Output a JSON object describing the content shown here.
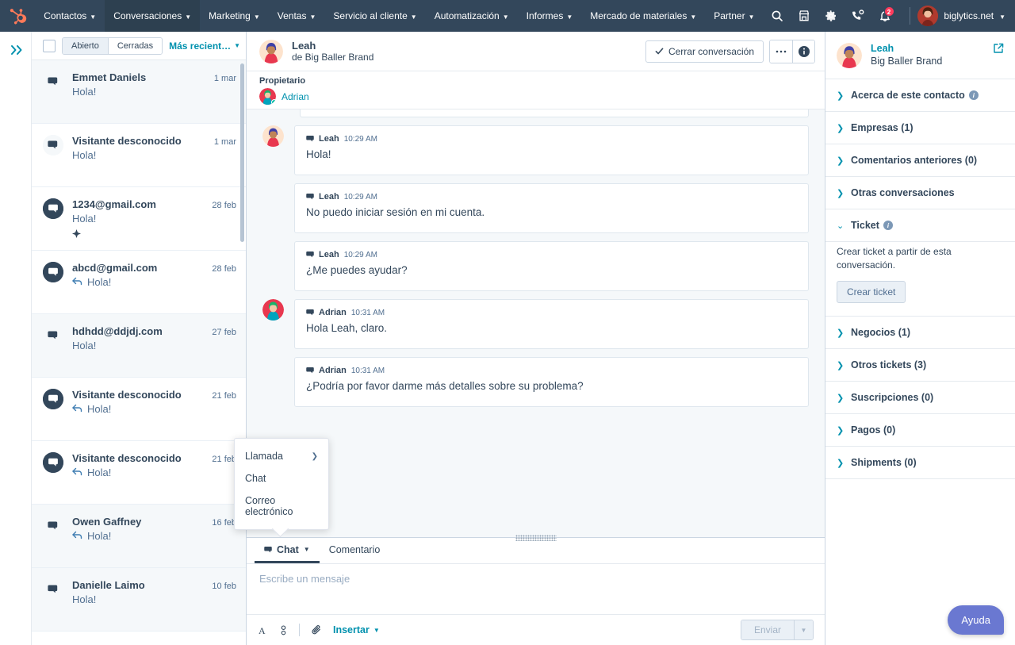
{
  "topnav": {
    "logo": "hubspot-logo",
    "items": [
      {
        "label": "Contactos",
        "caret": true,
        "active": false
      },
      {
        "label": "Conversaciones",
        "caret": true,
        "active": true
      },
      {
        "label": "Marketing",
        "caret": true,
        "active": false
      },
      {
        "label": "Ventas",
        "caret": true,
        "active": false
      },
      {
        "label": "Servicio al cliente",
        "caret": true,
        "active": false
      },
      {
        "label": "Automatización",
        "caret": true,
        "active": false
      },
      {
        "label": "Informes",
        "caret": true,
        "active": false
      },
      {
        "label": "Mercado de materiales",
        "caret": true,
        "active": false
      },
      {
        "label": "Partner",
        "caret": true,
        "active": false
      }
    ],
    "icons": [
      "search-icon",
      "marketplace-icon",
      "gear-icon",
      "calling-icon",
      "notifications-icon"
    ],
    "notification_count": "2",
    "account_name": "biglytics.net"
  },
  "rail": {
    "expand": "double-chevron-right-icon"
  },
  "list": {
    "filters": [
      {
        "label": "Abierto",
        "active": true
      },
      {
        "label": "Cerradas",
        "active": false
      }
    ],
    "sort_label": "Más recient…",
    "items": [
      {
        "name": "Emmet Daniels",
        "date": "1 mar",
        "preview": "Hola!",
        "replied": false,
        "avatar": "light",
        "selected": true,
        "mark": false
      },
      {
        "name": "Visitante desconocido",
        "date": "1 mar",
        "preview": "Hola!",
        "replied": false,
        "avatar": "light",
        "selected": false,
        "mark": false
      },
      {
        "name": "1234@gmail.com",
        "date": "28 feb",
        "preview": "Hola!",
        "replied": false,
        "avatar": "dark",
        "selected": false,
        "mark": true
      },
      {
        "name": "abcd@gmail.com",
        "date": "28 feb",
        "preview": "Hola!",
        "replied": true,
        "avatar": "dark",
        "selected": false,
        "mark": false
      },
      {
        "name": "hdhdd@ddjdj.com",
        "date": "27 feb",
        "preview": "Hola!",
        "replied": false,
        "avatar": "light",
        "selected": true,
        "mark": false
      },
      {
        "name": "Visitante desconocido",
        "date": "21 feb",
        "preview": "Hola!",
        "replied": true,
        "avatar": "dark",
        "selected": false,
        "mark": false
      },
      {
        "name": "Visitante desconocido",
        "date": "21 feb",
        "preview": "Hola!",
        "replied": true,
        "avatar": "dark",
        "selected": false,
        "mark": false
      },
      {
        "name": "Owen Gaffney",
        "date": "16 feb",
        "preview": "Hola!",
        "replied": true,
        "avatar": "light",
        "selected": true,
        "mark": false
      },
      {
        "name": "Danielle Laimo",
        "date": "10 feb",
        "preview": "Hola!",
        "replied": false,
        "avatar": "light",
        "selected": true,
        "mark": false
      }
    ]
  },
  "thread": {
    "contact_name": "Leah",
    "contact_sub": "de Big Baller Brand",
    "close_label": "Cerrar conversación",
    "more_icon": "ellipsis-icon",
    "info_icon": "info-circle-icon",
    "owner_label": "Propietario",
    "owner_name": "Adrian",
    "messages": [
      {
        "author": "Leah",
        "time": "10:29 AM",
        "text": "Hola!",
        "side": "contact",
        "show_avatar": true
      },
      {
        "author": "Leah",
        "time": "10:29 AM",
        "text": "No puedo iniciar sesión en mi cuenta.",
        "side": "contact",
        "show_avatar": false
      },
      {
        "author": "Leah",
        "time": "10:29 AM",
        "text": "¿Me puedes ayudar?",
        "side": "contact",
        "show_avatar": false
      },
      {
        "author": "Adrian",
        "time": "10:31 AM",
        "text": "Hola Leah, claro.",
        "side": "agent",
        "show_avatar": true
      },
      {
        "author": "Adrian",
        "time": "10:31 AM",
        "text": "¿Podría por favor darme más detalles sobre su problema?",
        "side": "agent",
        "show_avatar": false
      }
    ]
  },
  "popup": {
    "items": [
      {
        "label": "Llamada",
        "submenu": true
      },
      {
        "label": "Chat",
        "submenu": false
      },
      {
        "label": "Correo electrónico",
        "submenu": false
      }
    ]
  },
  "composer": {
    "tabs": [
      {
        "label": "Chat",
        "active": true,
        "icon": "chat-bubble-icon",
        "caret": true
      },
      {
        "label": "Comentario",
        "active": false,
        "icon": "",
        "caret": false
      }
    ],
    "placeholder": "Escribe un mensaje",
    "tools": [
      "font-icon",
      "format-icon",
      "attachment-icon"
    ],
    "insert_label": "Insertar",
    "send_label": "Enviar"
  },
  "right_panel": {
    "contact_name": "Leah",
    "company": "Big Baller Brand",
    "open_icon": "external-link-icon",
    "sections": [
      {
        "label": "Acerca de este contacto",
        "open": false,
        "info": true
      },
      {
        "label": "Empresas (1)",
        "open": false,
        "info": false
      },
      {
        "label": "Comentarios anteriores (0)",
        "open": false,
        "info": false
      },
      {
        "label": "Otras conversaciones",
        "open": false,
        "info": false
      },
      {
        "label": "Ticket",
        "open": true,
        "info": true
      },
      {
        "label": "Negocios (1)",
        "open": false,
        "info": false
      },
      {
        "label": "Otros tickets (3)",
        "open": false,
        "info": false
      },
      {
        "label": "Suscripciones (0)",
        "open": false,
        "info": false
      },
      {
        "label": "Pagos (0)",
        "open": false,
        "info": false
      },
      {
        "label": "Shipments (0)",
        "open": false,
        "info": false
      }
    ],
    "ticket_desc": "Crear ticket a partir de esta conversación.",
    "ticket_btn": "Crear ticket"
  },
  "help_button": "Ayuda",
  "colors": {
    "nav_bg": "#33475b",
    "accent_teal": "#0091ae",
    "orange": "#ff7a59",
    "badge_red": "#ff3b5c",
    "help_purple": "#6a78d1",
    "page_bg": "#f5f8fa"
  }
}
